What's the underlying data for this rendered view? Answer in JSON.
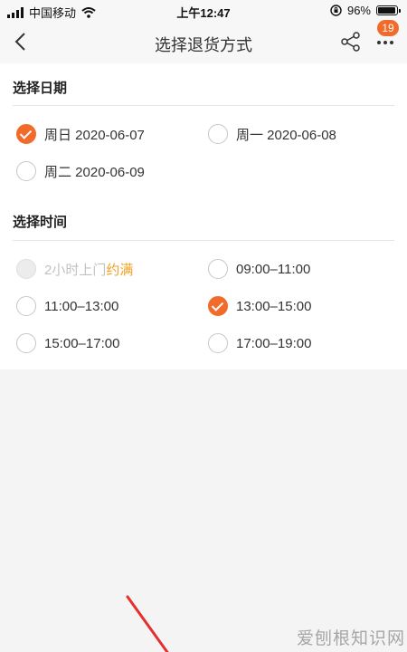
{
  "status_bar": {
    "carrier": "中国移动",
    "time": "上午12:47",
    "battery_percent": "96%",
    "battery_level": 0.96
  },
  "nav": {
    "title": "选择退货方式",
    "badge_count": "19",
    "icons": [
      "back-arrow-icon",
      "share-icon",
      "more-icon"
    ]
  },
  "date_section": {
    "title": "选择日期",
    "options": [
      {
        "label": "周日 2020-06-07",
        "checked": true
      },
      {
        "label": "周一 2020-06-08",
        "checked": false
      },
      {
        "label": "周二 2020-06-09",
        "checked": false
      }
    ]
  },
  "time_section": {
    "title": "选择时间",
    "options": [
      {
        "label": "2小时上门",
        "extra": "约满",
        "disabled": true,
        "checked": false
      },
      {
        "label": "09:00–11:00",
        "checked": false
      },
      {
        "label": "11:00–13:00",
        "checked": false
      },
      {
        "label": "13:00–15:00",
        "checked": true
      },
      {
        "label": "15:00–17:00",
        "checked": false
      },
      {
        "label": "17:00–19:00",
        "checked": false
      }
    ]
  },
  "watermark": "爱刨根知识网",
  "colors": {
    "accent": "#f26b2a",
    "full_tag": "#f0a020",
    "background": "#f4f4f4"
  }
}
